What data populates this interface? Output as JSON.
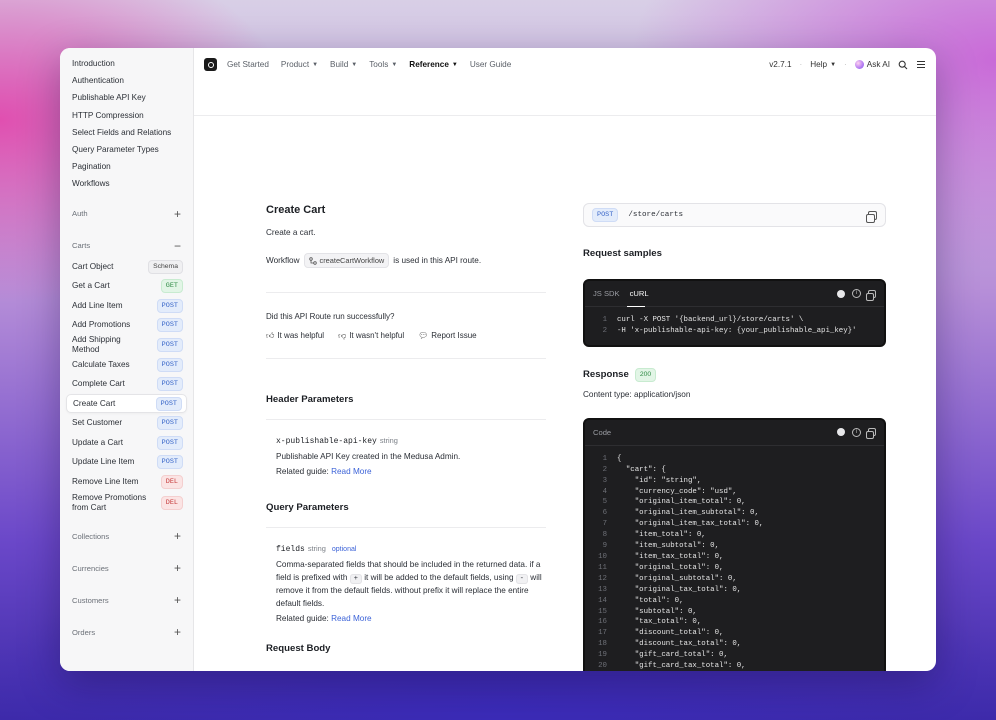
{
  "sidebar": {
    "top_links": [
      "Introduction",
      "Authentication",
      "Publishable API Key",
      "HTTP Compression",
      "Select Fields and Relations",
      "Query Parameter Types",
      "Pagination",
      "Workflows"
    ],
    "sections": {
      "auth": "Auth",
      "carts": "Carts",
      "collections": "Collections",
      "currencies": "Currencies",
      "customers": "Customers",
      "orders": "Orders"
    },
    "cart_items": [
      {
        "label": "Cart Object",
        "badge": "Schema",
        "kind": "schema"
      },
      {
        "label": "Get a Cart",
        "badge": "GET",
        "kind": "get"
      },
      {
        "label": "Add Line Item",
        "badge": "POST",
        "kind": "post"
      },
      {
        "label": "Add Promotions",
        "badge": "POST",
        "kind": "post"
      },
      {
        "label": "Add Shipping Method",
        "badge": "POST",
        "kind": "post"
      },
      {
        "label": "Calculate Taxes",
        "badge": "POST",
        "kind": "post"
      },
      {
        "label": "Complete Cart",
        "badge": "POST",
        "kind": "post"
      },
      {
        "label": "Create Cart",
        "badge": "POST",
        "kind": "post",
        "active": true
      },
      {
        "label": "Set Customer",
        "badge": "POST",
        "kind": "post"
      },
      {
        "label": "Update a Cart",
        "badge": "POST",
        "kind": "post"
      },
      {
        "label": "Update Line Item",
        "badge": "POST",
        "kind": "post"
      },
      {
        "label": "Remove Line Item",
        "badge": "DEL",
        "kind": "del"
      },
      {
        "label": "Remove Promotions from Cart",
        "badge": "DEL",
        "kind": "del"
      }
    ]
  },
  "topbar": {
    "nav": [
      {
        "label": "Get Started",
        "caret": false
      },
      {
        "label": "Product",
        "caret": true
      },
      {
        "label": "Build",
        "caret": true
      },
      {
        "label": "Tools",
        "caret": true
      },
      {
        "label": "Reference",
        "caret": true,
        "active": true
      },
      {
        "label": "User Guide",
        "caret": false
      }
    ],
    "version": "v2.7.1",
    "help": "Help",
    "ask_ai": "Ask AI"
  },
  "main": {
    "title": "Create Cart",
    "description": "Create a cart.",
    "workflow_prefix": "Workflow",
    "workflow_name": "createCartWorkflow",
    "workflow_suffix": "is used in this API route.",
    "feedback_question": "Did this API Route run successfully?",
    "feedback": {
      "helpful": "It was helpful",
      "not_helpful": "It wasn't helpful",
      "report": "Report Issue"
    },
    "header_params_title": "Header Parameters",
    "header_param": {
      "name": "x-publishable-api-key",
      "type": "string",
      "description": "Publishable API Key created in the Medusa Admin.",
      "related_label": "Related guide:",
      "related_link": "Read More"
    },
    "query_params_title": "Query Parameters",
    "query_param": {
      "name": "fields",
      "type": "string",
      "optional": "optional",
      "text_1": "Comma-separated fields that should be included in the returned data. if a field is prefixed with",
      "code_plus": "+",
      "text_2": "it will be added to the default fields, using",
      "code_minus": "-",
      "text_3": "will remove it from the default fields. without prefix it will replace the entire default fields.",
      "related_label": "Related guide:",
      "related_link": "Read More"
    },
    "request_body_title": "Request Body"
  },
  "right": {
    "method": "POST",
    "path": "/store/carts",
    "samples_title": "Request samples",
    "sample_tabs": [
      "JS SDK",
      "cURL"
    ],
    "sample_active_tab": "cURL",
    "sample_lines": [
      "curl -X POST '{backend_url}/store/carts' \\",
      "-H 'x-publishable-api-key: {your_publishable_api_key}'"
    ],
    "response_title": "Response",
    "response_code": "200",
    "content_type": "Content type: application/json",
    "code_label": "Code",
    "response_lines": [
      "{",
      "  \"cart\": {",
      "    \"id\": \"string\",",
      "    \"currency_code\": \"usd\",",
      "    \"original_item_total\": 0,",
      "    \"original_item_subtotal\": 0,",
      "    \"original_item_tax_total\": 0,",
      "    \"item_total\": 0,",
      "    \"item_subtotal\": 0,",
      "    \"item_tax_total\": 0,",
      "    \"original_total\": 0,",
      "    \"original_subtotal\": 0,",
      "    \"original_tax_total\": 0,",
      "    \"total\": 0,",
      "    \"subtotal\": 0,",
      "    \"tax_total\": 0,",
      "    \"discount_total\": 0,",
      "    \"discount_tax_total\": 0,",
      "    \"gift_card_total\": 0,",
      "    \"gift_card_tax_total\": 0,"
    ]
  }
}
